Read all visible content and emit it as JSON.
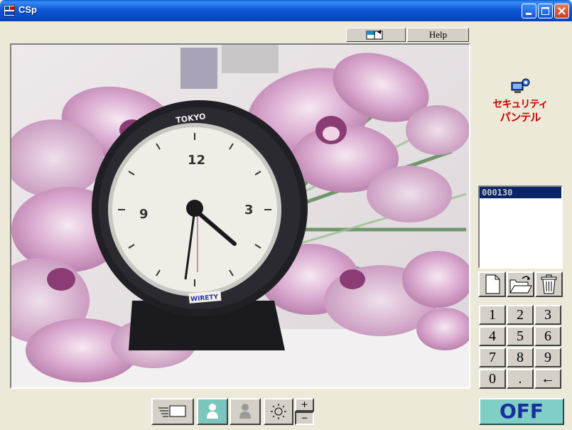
{
  "window": {
    "title": "CSp"
  },
  "toolbar": {
    "layout_icon": "window-layout-icon",
    "help_label": "Help"
  },
  "logo": {
    "line1": "セキュリティ",
    "line2": "パンテル",
    "icon": "computer-camera-icon"
  },
  "list": {
    "items": [
      "000130"
    ]
  },
  "file_buttons": [
    {
      "name": "new-file-icon"
    },
    {
      "name": "open-folder-icon"
    },
    {
      "name": "trash-icon"
    }
  ],
  "keypad": {
    "keys": [
      "1",
      "2",
      "3",
      "4",
      "5",
      "6",
      "7",
      "8",
      "9",
      "0",
      ".",
      "←"
    ]
  },
  "bottom_toolbar": {
    "icons": [
      "list-window-icon",
      "person-icon",
      "person-disabled-icon",
      "brightness-icon"
    ],
    "plus_label": "+",
    "minus_label": "−"
  },
  "power": {
    "label": "OFF"
  },
  "video": {
    "clock_brand": "TOKYO",
    "clock_numbers": [
      "12",
      "3",
      "9"
    ],
    "clock_sticker": "WIRETY"
  },
  "colors": {
    "titlebar": "#0a5fd8",
    "power_button": "#80cfc7",
    "logo_text": "#cc0000",
    "list_selected": "#0a246a"
  }
}
